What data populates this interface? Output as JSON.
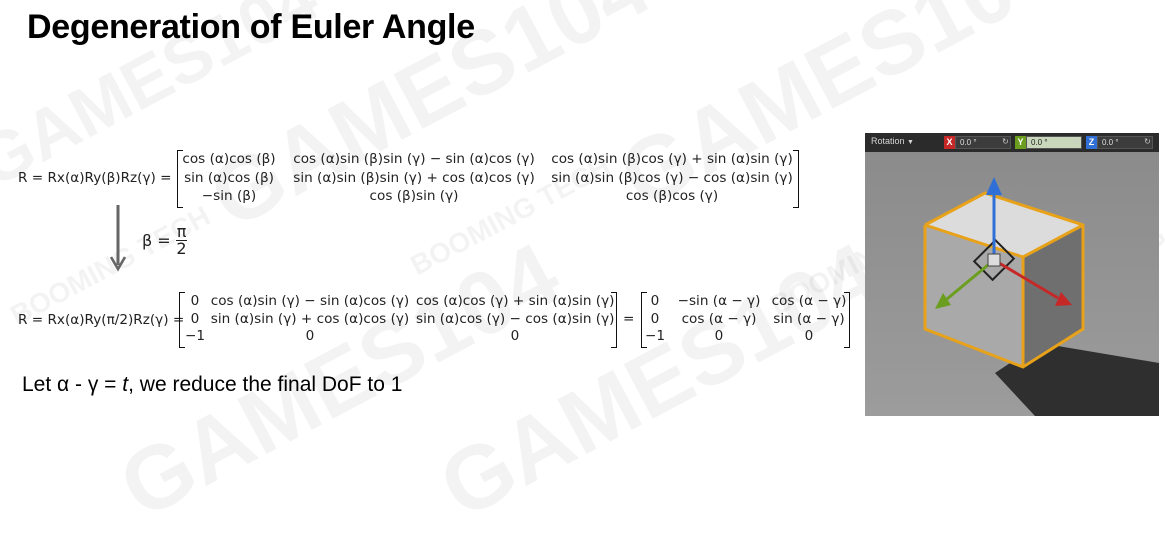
{
  "title": "Degeneration of Euler Angle",
  "watermarks": [
    "GAMES104",
    "GAMES104",
    "GAMES104",
    "BOOMING TECH",
    "BOOMING TECH",
    "BOOMING TECH",
    "BOOMING TECH",
    "GAMES104",
    "GAMES104"
  ],
  "eq1": {
    "lhs": "R = Rx(α)Ry(β)Rz(γ) =",
    "rows": [
      [
        "cos (α)cos (β)",
        "cos (α)sin (β)sin (γ) − sin (α)cos (γ)",
        "cos (α)sin (β)cos (γ) + sin (α)sin (γ)"
      ],
      [
        "sin (α)cos (β)",
        "sin (α)sin (β)sin (γ) + cos (α)cos (γ)",
        "sin (α)sin (β)cos (γ) − cos (α)sin (γ)"
      ],
      [
        "−sin (β)",
        "cos (β)sin (γ)",
        "cos (β)cos (γ)"
      ]
    ]
  },
  "step": {
    "lhs": "β =",
    "num": "π",
    "den": "2"
  },
  "eq2": {
    "lhs": "R = Rx(α)Ry(π/2)Rz(γ) =",
    "rows": [
      [
        "0",
        "cos (α)sin (γ) − sin (α)cos (γ)",
        "cos (α)cos (γ) + sin (α)sin (γ)"
      ],
      [
        "0",
        "sin (α)sin (γ) + cos (α)cos (γ)",
        "sin (α)cos (γ) − cos (α)sin (γ)"
      ],
      [
        "−1",
        "0",
        "0"
      ]
    ],
    "equals": "=",
    "rows2": [
      [
        "0",
        "−sin (α − γ)",
        "cos (α − γ)"
      ],
      [
        "0",
        "cos (α − γ)",
        "sin (α − γ)"
      ],
      [
        "−1",
        "0",
        "0"
      ]
    ]
  },
  "note": {
    "prefix": "Let α - γ = ",
    "var": "t",
    "suffix": ", we reduce the final DoF to 1"
  },
  "viewport": {
    "rotation_label": "Rotation",
    "dropdown_icon": "caret-down-icon",
    "x_label": "X",
    "x_value": "0.0 °",
    "y_label": "Y",
    "y_value": "0.0 °",
    "z_label": "Z",
    "z_value": "0.0 °",
    "reset_icon": "reset-arrow-icon",
    "colors": {
      "x": "#c62828",
      "y": "#6b9e1f",
      "z": "#2f6fd6",
      "box_outline": "#e8a21a"
    }
  }
}
